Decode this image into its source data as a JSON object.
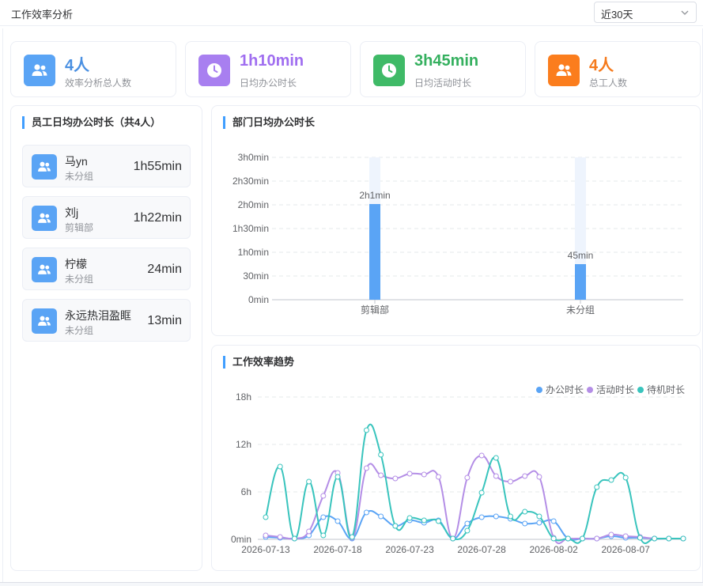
{
  "header": {
    "title": "工作效率分析",
    "range_selected": "近30天"
  },
  "colors": {
    "blue": "#5aa4f5",
    "purple": "#a87ff0",
    "green": "#3fba67",
    "orange": "#fb7d1d",
    "accent": "#409eff",
    "office": "#5aa4f5",
    "activity": "#b48ee6",
    "standby": "#39c4bd"
  },
  "stats": [
    {
      "value": "4人",
      "label": "效率分析总人数",
      "icon": "users-icon"
    },
    {
      "value": "1h10min",
      "label": "日均办公时长",
      "icon": "clock-icon"
    },
    {
      "value": "3h45min",
      "label": "日均活动时长",
      "icon": "clock-icon"
    },
    {
      "value": "4人",
      "label": "总工人数",
      "icon": "users-icon"
    }
  ],
  "employees": {
    "title": "员工日均办公时长（共4人）",
    "items": [
      {
        "name": "马yn",
        "dept": "未分组",
        "time": "1h55min"
      },
      {
        "name": "刘j",
        "dept": "剪辑部",
        "time": "1h22min"
      },
      {
        "name": "柠檬",
        "dept": "未分组",
        "time": "24min"
      },
      {
        "name": "永远热泪盈眶",
        "dept": "未分组",
        "time": "13min"
      }
    ]
  },
  "dept_chart": {
    "title": "部门日均办公时长"
  },
  "trend_chart": {
    "title": "工作效率趋势"
  },
  "chart_data": [
    {
      "type": "bar",
      "title": "部门日均办公时长",
      "categories": [
        "剪辑部",
        "未分组"
      ],
      "values": [
        121,
        45
      ],
      "value_labels": [
        "2h1min",
        "45min"
      ],
      "background_max": 180,
      "y_ticks": [
        0,
        30,
        60,
        90,
        120,
        150,
        180
      ],
      "y_tick_labels": [
        "0min",
        "30min",
        "1h0min",
        "1h30min",
        "2h0min",
        "2h30min",
        "3h0min"
      ],
      "ylim": [
        0,
        180
      ],
      "grid": true,
      "unit": "min"
    },
    {
      "type": "line",
      "title": "工作效率趋势",
      "legend_position": "top-right",
      "ylim": [
        0,
        18
      ],
      "y_ticks": [
        0,
        6,
        12,
        18
      ],
      "y_tick_labels": [
        "0min",
        "6h",
        "12h",
        "18h"
      ],
      "x": [
        "2026-07-13",
        "2026-07-14",
        "2026-07-15",
        "2026-07-16",
        "2026-07-17",
        "2026-07-18",
        "2026-07-19",
        "2026-07-20",
        "2026-07-21",
        "2026-07-22",
        "2026-07-23",
        "2026-07-24",
        "2026-07-25",
        "2026-07-26",
        "2026-07-27",
        "2026-07-28",
        "2026-07-29",
        "2026-07-30",
        "2026-07-31",
        "2026-08-01",
        "2026-08-02",
        "2026-08-03",
        "2026-08-04",
        "2026-08-05",
        "2026-08-06",
        "2026-08-07",
        "2026-08-08",
        "2026-08-09",
        "2026-08-10",
        "2026-08-11"
      ],
      "x_tick_labels": [
        "2026-07-13",
        "2026-07-18",
        "2026-07-23",
        "2026-07-28",
        "2026-08-02",
        "2026-08-07"
      ],
      "grid": true,
      "series": [
        {
          "name": "办公时长",
          "color": "#5aa4f5",
          "values": [
            0.3,
            0.2,
            0.1,
            0.5,
            2.8,
            2.3,
            0.1,
            3.4,
            2.9,
            1.7,
            2.4,
            2.1,
            2.4,
            0.1,
            2.0,
            2.8,
            2.9,
            2.6,
            2.0,
            2.1,
            2.3,
            0.1,
            0.1,
            0.1,
            0.4,
            0.2,
            0.2,
            0.1,
            0.1,
            0.1
          ]
        },
        {
          "name": "活动时长",
          "color": "#b48ee6",
          "values": [
            0.5,
            0.3,
            0.1,
            1.0,
            5.5,
            8.4,
            0.2,
            9.0,
            8.1,
            7.7,
            8.3,
            8.2,
            7.9,
            0.1,
            7.8,
            10.6,
            8.0,
            7.3,
            8.0,
            7.9,
            0.2,
            0.1,
            0.1,
            0.1,
            0.6,
            0.4,
            0.3,
            0.1,
            0.1,
            0.1
          ]
        },
        {
          "name": "待机时长",
          "color": "#39c4bd",
          "values": [
            2.8,
            9.2,
            0.1,
            7.3,
            0.5,
            7.9,
            0.3,
            13.8,
            10.7,
            1.7,
            2.7,
            2.4,
            2.3,
            0.1,
            1.1,
            5.9,
            10.3,
            2.9,
            3.5,
            2.9,
            0.1,
            0.1,
            0.1,
            6.6,
            7.5,
            7.8,
            0.2,
            0.1,
            0.1,
            0.1
          ]
        }
      ]
    }
  ]
}
